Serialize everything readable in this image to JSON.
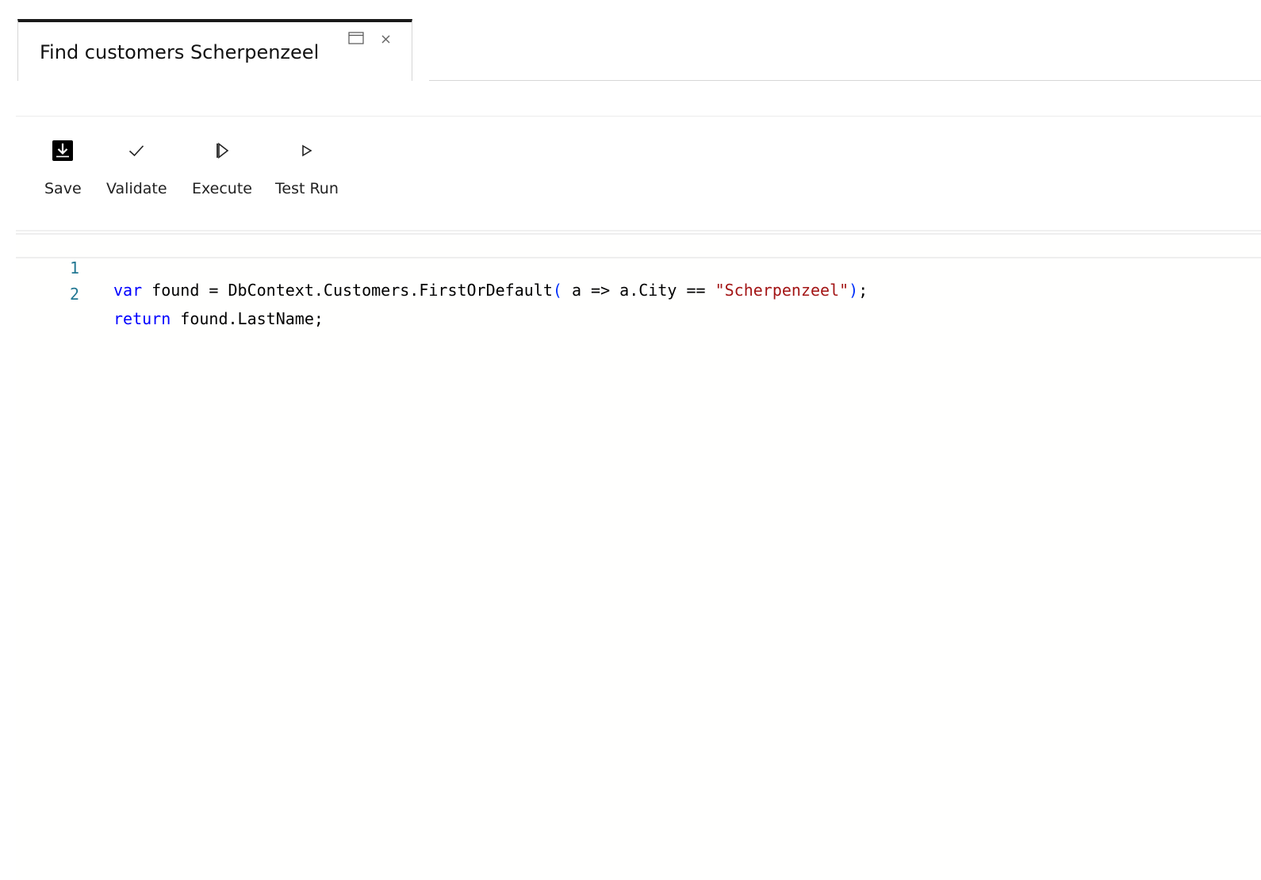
{
  "tab": {
    "title": "Find customers Scherpenzeel",
    "popout_icon": "popout-window-icon",
    "close_icon": "close-icon"
  },
  "toolbar": {
    "save_label": "Save",
    "validate_label": "Validate",
    "execute_label": "Execute",
    "test_run_label": "Test Run",
    "save_icon": "save-download-icon",
    "validate_icon": "checkmark-icon",
    "execute_icon": "execute-play-icon",
    "test_run_icon": "play-outline-icon"
  },
  "editor": {
    "lines": [
      {
        "number": "1",
        "tokens": {
          "kw": "var",
          "t1": " found = DbContext.Customers.FirstOrDefault",
          "p1": "(",
          "t2": " a => a.City == ",
          "str": "\"Scherpenzeel\"",
          "p2": ")",
          "t3": ";"
        }
      },
      {
        "number": "2",
        "tokens": {
          "kw": "return",
          "t1": " found.LastName;"
        }
      }
    ]
  },
  "colors": {
    "keyword": "#0000ff",
    "string": "#a31515",
    "line_number": "#237893",
    "tab_accent": "#1a1a1a"
  }
}
